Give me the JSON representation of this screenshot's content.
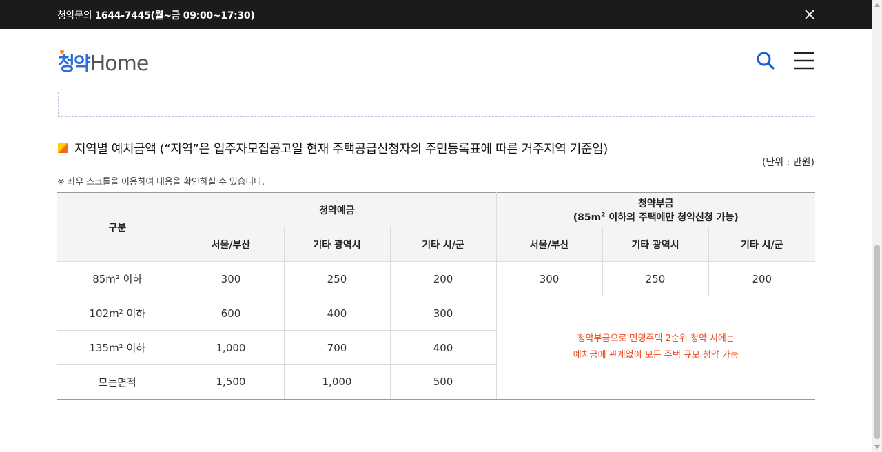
{
  "topbar": {
    "notice_label": "청약문의",
    "notice_phone": "1644-7445",
    "notice_hours": "(월~금 09:00~17:30)"
  },
  "header": {
    "logo_ko": "청약",
    "logo_en": "Home"
  },
  "section": {
    "title": "지역별 예치금액 (“지역”은 입주자모집공고일 현재 주택공급신청자의 주민등록표에 따른 거주지역 기준임)",
    "unit": "(단위 : 만원)",
    "scroll_note": "※ 좌우 스크롤을 이용하여 내용을 확인하실 수 있습니다."
  },
  "table": {
    "col_category": "구분",
    "group_deposit": "청약예금",
    "group_installment_line1": "청약부금",
    "group_installment_line2_prefix": "(85m",
    "group_installment_sup": "2",
    "group_installment_line2_suffix": " 이하의 주택에만 청약신청 가능)",
    "sub_headers": [
      "서울/부산",
      "기타 광역시",
      "기타 시/군",
      "서울/부산",
      "기타 광역시",
      "기타 시/군"
    ],
    "rows": [
      {
        "label": "85m² 이하",
        "deposit": [
          "300",
          "250",
          "200"
        ],
        "installment": [
          "300",
          "250",
          "200"
        ]
      },
      {
        "label": "102m² 이하",
        "deposit": [
          "600",
          "400",
          "300"
        ]
      },
      {
        "label": "135m² 이하",
        "deposit": [
          "1,000",
          "700",
          "400"
        ]
      },
      {
        "label": "모든면적",
        "deposit": [
          "1,500",
          "1,000",
          "500"
        ]
      }
    ],
    "merged_note_line1": "청약부금으로 민영주택 2순위 청약 시에는",
    "merged_note_line2": "예치금에 관계없이 모든 주택 규모 청약 가능"
  },
  "colors": {
    "topbar_bg": "#1b1b1b",
    "brand_blue": "#2b6ed9",
    "note_red": "#f0451c",
    "header_cell_bg": "#f4f4f4"
  },
  "icons": {
    "close": "close-icon",
    "search": "search-icon",
    "menu": "hamburger-menu-icon",
    "bullet": "square-bullet-icon"
  }
}
